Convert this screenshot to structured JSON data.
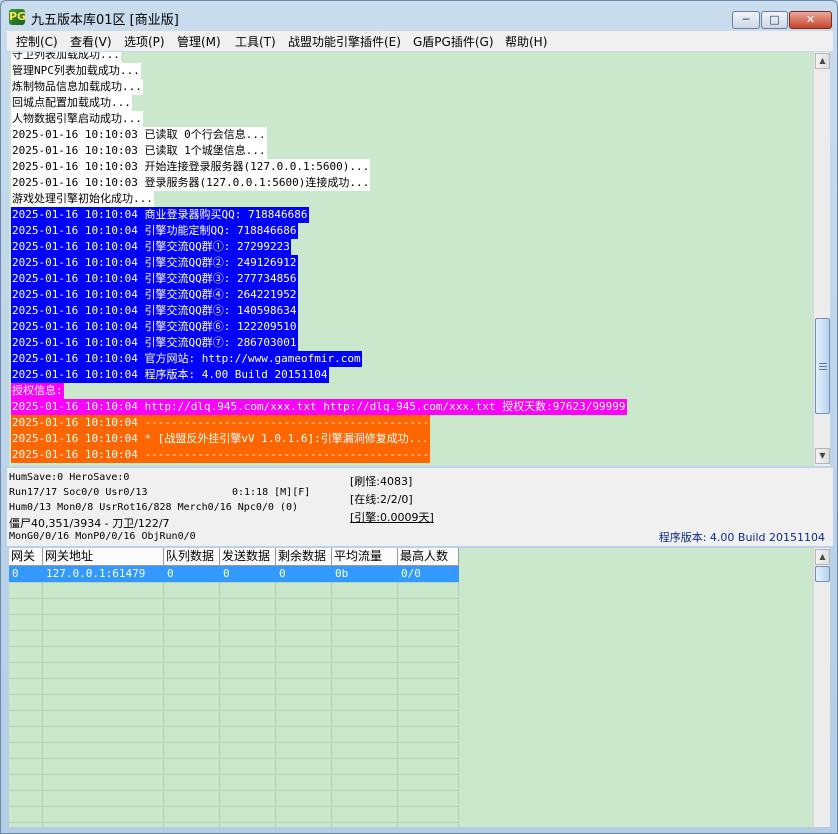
{
  "window": {
    "title": "九五版本库01区 [商业版]",
    "icon_text": "PG"
  },
  "titlebar_buttons": {
    "minimize": "─",
    "maximize": "□",
    "close": "✕"
  },
  "menu": [
    "控制(C)",
    "查看(V)",
    "选项(P)",
    "管理(M)",
    "工具(T)",
    "战盟功能引擎插件(E)",
    "G盾PG插件(G)",
    "帮助(H)"
  ],
  "log": [
    {
      "text": "守卫列表加载成功...",
      "style": "white"
    },
    {
      "text": "管理NPC列表加载成功...",
      "style": "white"
    },
    {
      "text": "炼制物品信息加载成功...",
      "style": "white"
    },
    {
      "text": "回城点配置加载成功...",
      "style": "white"
    },
    {
      "text": "人物数据引擎启动成功...",
      "style": "white"
    },
    {
      "text": "2025-01-16 10:10:03 已读取 0个行会信息...",
      "style": "white"
    },
    {
      "text": "2025-01-16 10:10:03 已读取 1个城堡信息...",
      "style": "white"
    },
    {
      "text": "2025-01-16 10:10:03 开始连接登录服务器(127.0.0.1:5600)...",
      "style": "white"
    },
    {
      "text": "2025-01-16 10:10:03 登录服务器(127.0.0.1:5600)连接成功...",
      "style": "white"
    },
    {
      "text": "游戏处理引擎初始化成功...",
      "style": "white"
    },
    {
      "text": "2025-01-16 10:10:04 商业登录器购买QQ: 718846686",
      "style": "blue"
    },
    {
      "text": "2025-01-16 10:10:04 引擎功能定制QQ: 718846686",
      "style": "blue"
    },
    {
      "text": "2025-01-16 10:10:04 引擎交流QQ群①: 27299223",
      "style": "blue"
    },
    {
      "text": "2025-01-16 10:10:04 引擎交流QQ群②: 249126912",
      "style": "blue"
    },
    {
      "text": "2025-01-16 10:10:04 引擎交流QQ群③: 277734856",
      "style": "blue"
    },
    {
      "text": "2025-01-16 10:10:04 引擎交流QQ群④: 264221952",
      "style": "blue"
    },
    {
      "text": "2025-01-16 10:10:04 引擎交流QQ群⑤: 140598634",
      "style": "blue"
    },
    {
      "text": "2025-01-16 10:10:04 引擎交流QQ群⑥: 122209510",
      "style": "blue"
    },
    {
      "text": "2025-01-16 10:10:04 引擎交流QQ群⑦: 286703001",
      "style": "blue"
    },
    {
      "text": "2025-01-16 10:10:04 官方网站: http://www.gameofmir.com",
      "style": "blue"
    },
    {
      "text": "2025-01-16 10:10:04 程序版本: 4.00 Build 20151104",
      "style": "blue"
    },
    {
      "text": "授权信息:",
      "style": "magenta"
    },
    {
      "text": "2025-01-16 10:10:04 http://dlq.945.com/xxx.txt http://dlq.945.com/xxx.txt 授权天数:97623/99999",
      "style": "magenta"
    },
    {
      "text": "2025-01-16 10:10:04 -------------------------------------------",
      "style": "orange"
    },
    {
      "text": "2025-01-16 10:10:04 * [战盟反外挂引擎vV 1.0.1.6]:引擎漏洞修复成功...",
      "style": "orange"
    },
    {
      "text": "2025-01-16 10:10:04 -------------------------------------------",
      "style": "orange"
    }
  ],
  "status": {
    "line1": "HumSave:0 HeroSave:0",
    "line2a": "Run17/17 Soc0/0 Usr0/13",
    "line2b": "0:1:18 [M][F]",
    "line3": "Hum0/13 Mon0/8 UsrRot16/828 Merch0/16 Npc0/0 (0)",
    "line4": "僵尸40,351/3934 - 刀卫/122/7",
    "line5": "MonG0/0/16 MonP0/0/16 ObjRun0/0",
    "refresh_monster": "[刷怪:4083]",
    "online": "[在线:2/2/0]",
    "engine": "[引擎:0.0009天]",
    "version": "程序版本: 4.00 Build 20151104"
  },
  "gate_table": {
    "headers": [
      "网关",
      "网关地址",
      "队列数据",
      "发送数据",
      "剩余数据",
      "平均流量",
      "最高人数"
    ],
    "rows": [
      [
        "0",
        "127.0.0.1:61479",
        "0",
        "0",
        "0",
        "0b",
        "0/0"
      ]
    ]
  },
  "scrollbar": {
    "up": "▲",
    "down": "▼"
  }
}
